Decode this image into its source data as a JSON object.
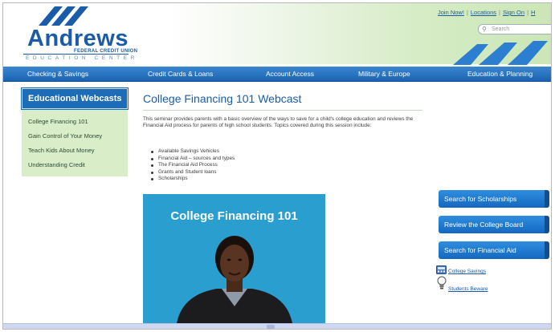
{
  "header": {
    "logo_name": "Andrews",
    "logo_subtitle": "FEDERAL CREDIT UNION",
    "logo_tagline": "EDUCATION CENTER",
    "top_links": [
      "Join Now!",
      "Locations",
      "Sign On",
      "H"
    ],
    "search_placeholder": "Search",
    "brand_color": "#1a5ca8"
  },
  "nav": {
    "items": [
      "Checking & Savings",
      "Credit Cards & Loans",
      "Account Access",
      "Military & Europe",
      "Education & Planning"
    ]
  },
  "sidebar": {
    "title": "Educational Webcasts",
    "items": [
      "College Financing 101",
      "Gain Control of Your Money",
      "Teach Kids About Money",
      "Understanding Credit"
    ]
  },
  "main": {
    "title": "College Financing 101 Webcast",
    "intro": "This seminar provides parents with a basic overview of the ways to save for a child's college education and reviews the Financial Aid process for parents of high school students. Topics covered during this session include:",
    "topics": [
      "Available Savings Vehicles",
      "Financial Aid – sources and types",
      "The Financial Aid Process",
      "Grants and Student loans",
      "Scholarships"
    ],
    "video_title": "College Financing 101"
  },
  "right": {
    "buttons": [
      "Search for Scholarships",
      "Review the College Board",
      "Search for Financial Aid"
    ],
    "resources": [
      {
        "label": "College Savings",
        "icon": "calculator-icon"
      },
      {
        "label": "Students Beware",
        "icon": "lightbulb-icon"
      }
    ]
  }
}
